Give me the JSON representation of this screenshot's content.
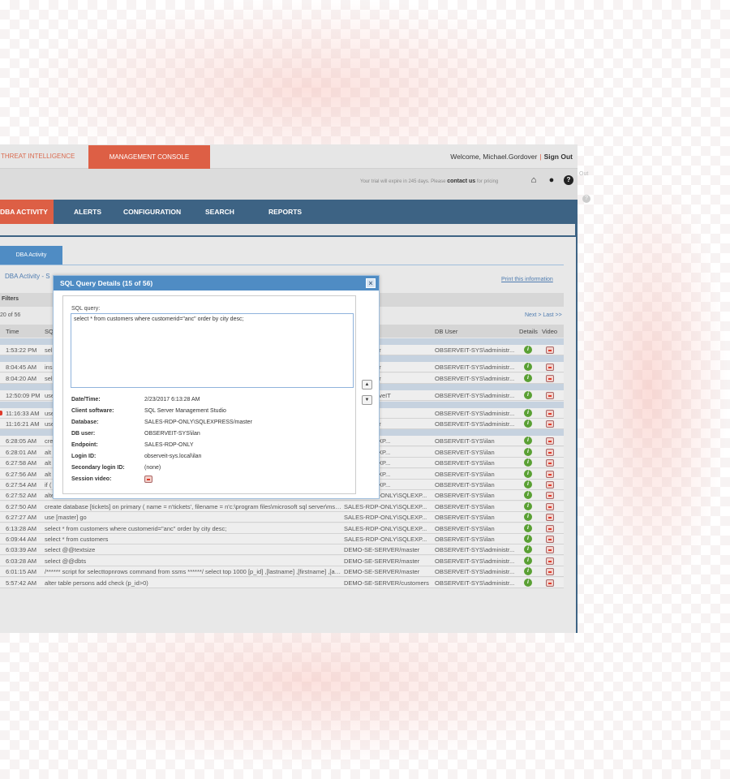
{
  "header": {
    "threat_tab": "THREAT INTELLIGENCE",
    "threat_tab_visible": "HREAT INTELLIGENCE",
    "mgmt_tab": "MANAGEMENT CONSOLE",
    "welcome": "Welcome, Michael.Gordover",
    "sign_out": "Sign Out",
    "trial_prefix": "Your trial will expire in 245 days. Please",
    "contact": "contact us",
    "trial_suffix": "for pricing",
    "ghost_out": "Out",
    "ghost_help": "?"
  },
  "nav": {
    "items": [
      "DBA ACTIVITY",
      "ALERTS",
      "CONFIGURATION",
      "SEARCH",
      "REPORTS"
    ],
    "active_visible": "DBA ACTIVITY"
  },
  "page": {
    "tab": "DBA Activity",
    "breadcrumb": "DBA Activity - S",
    "print": "Print this information",
    "filters": "Filters",
    "count": "20 of 56",
    "pager": "Next > Last >>"
  },
  "table": {
    "headers": {
      "time": "Time",
      "sql": "SQL",
      "db": "Database",
      "user": "DB User",
      "details": "Details",
      "video": "Video"
    },
    "rows": [
      {
        "group_before": true,
        "time": "1:53:22 PM",
        "sql": "sel",
        "db": "RVER/master",
        "user": "OBSERVEIT-SYS\\administr..."
      },
      {
        "group_before": true,
        "time": "8:04:45 AM",
        "sql": "ins",
        "db": "RVER/master",
        "user": "OBSERVEIT-SYS\\administr..."
      },
      {
        "time": "8:04:20 AM",
        "sql": "sel",
        "db": "RVER/master",
        "user": "OBSERVEIT-SYS\\administr..."
      },
      {
        "group_before": true,
        "time": "12:50:09 PM",
        "sql": "use",
        "db": "RVER/ObserveIT",
        "user": "OBSERVEIT-SYS\\administr..."
      },
      {
        "group_before": true,
        "flag": true,
        "time": "11:16:33 AM",
        "sql": "use",
        "db": "RVER/msdb",
        "user": "OBSERVEIT-SYS\\administr..."
      },
      {
        "time": "11:16:21 AM",
        "sql": "use",
        "db": "RVER/master",
        "user": "OBSERVEIT-SYS\\administr..."
      },
      {
        "group_before": true,
        "time": "6:28:05 AM",
        "sql": "cre",
        "db": "ONLY\\SQLEXP...",
        "user": "OBSERVEIT-SYS\\ilan"
      },
      {
        "time": "6:28:01 AM",
        "sql": "alt",
        "db": "ONLY\\SQLEXP...",
        "user": "OBSERVEIT-SYS\\ilan"
      },
      {
        "time": "6:27:58 AM",
        "sql": "alt",
        "db": "ONLY\\SQLEXP...",
        "user": "OBSERVEIT-SYS\\ilan"
      },
      {
        "time": "6:27:56 AM",
        "sql": "alt",
        "db": "ONLY\\SQLEXP...",
        "user": "OBSERVEIT-SYS\\ilan"
      },
      {
        "time": "6:27:54 AM",
        "sql": "if (",
        "db": "ONLY\\SQLEXP...",
        "user": "OBSERVEIT-SYS\\ilan"
      },
      {
        "time": "6:27:52 AM",
        "sql": "alter database [tickets] set compatibility_level = 100 go",
        "db": "SALES-RDP-ONLY\\SQLEXP...",
        "user": "OBSERVEIT-SYS\\ilan"
      },
      {
        "time": "6:27:50 AM",
        "sql": "create database [tickets] on primary ( name = n'tickets', filename = n'c:\\program files\\microsoft sql server\\mssq...",
        "db": "SALES-RDP-ONLY\\SQLEXP...",
        "user": "OBSERVEIT-SYS\\ilan"
      },
      {
        "time": "6:27:27 AM",
        "sql": "use [master] go",
        "db": "SALES-RDP-ONLY\\SQLEXP...",
        "user": "OBSERVEIT-SYS\\ilan"
      },
      {
        "time": "6:13:28 AM",
        "sql": "select * from customers where customerid=\"anc\" order by city desc;",
        "db": "SALES-RDP-ONLY\\SQLEXP...",
        "user": "OBSERVEIT-SYS\\ilan"
      },
      {
        "time": "6:09:44 AM",
        "sql": "select * from customers",
        "db": "SALES-RDP-ONLY\\SQLEXP...",
        "user": "OBSERVEIT-SYS\\ilan"
      },
      {
        "time": "6:03:39 AM",
        "sql": "select @@textsize",
        "db": "DEMO-SE-SERVER/master",
        "user": "OBSERVEIT-SYS\\administr..."
      },
      {
        "time": "6:03:28 AM",
        "sql": "select @@dbts",
        "db": "DEMO-SE-SERVER/master",
        "user": "OBSERVEIT-SYS\\administr..."
      },
      {
        "time": "6:01:15 AM",
        "sql": "/****** script for selecttopnrows command from ssms ******/ select top 1000 [p_id] ,[lastname] ,[firstname] ,[add...",
        "db": "DEMO-SE-SERVER/master",
        "user": "OBSERVEIT-SYS\\administr..."
      },
      {
        "time": "5:57:42 AM",
        "sql": "alter table persons add check (p_id>0)",
        "db": "DEMO-SE-SERVER/customers",
        "user": "OBSERVEIT-SYS\\administr..."
      }
    ]
  },
  "modal": {
    "title": "SQL Query Details (15 of 56)",
    "close": "×",
    "sql_label": "SQL query:",
    "sql": "select * from customers where customerid=\"anc\" order by city desc;",
    "fields": [
      {
        "label": "Date/Time:",
        "value": "2/23/2017 6:13:28 AM"
      },
      {
        "label": "Client software:",
        "value": "SQL Server Management Studio"
      },
      {
        "label": "Database:",
        "value": "SALES-RDP-ONLY\\SQLEXPRESS/master"
      },
      {
        "label": "DB user:",
        "value": "OBSERVEIT-SYS\\ilan"
      },
      {
        "label": "Endpoint:",
        "value": "SALES-RDP-ONLY"
      },
      {
        "label": "Login ID:",
        "value": "observeit-sys.local\\ilan"
      },
      {
        "label": "Secondary login ID:",
        "value": "(none)"
      },
      {
        "label": "Session video:",
        "value": ""
      }
    ]
  },
  "colors": {
    "accent": "#dd5f45",
    "nav": "#3d6384",
    "blue": "#4f8cc4",
    "info": "#5aa034"
  }
}
